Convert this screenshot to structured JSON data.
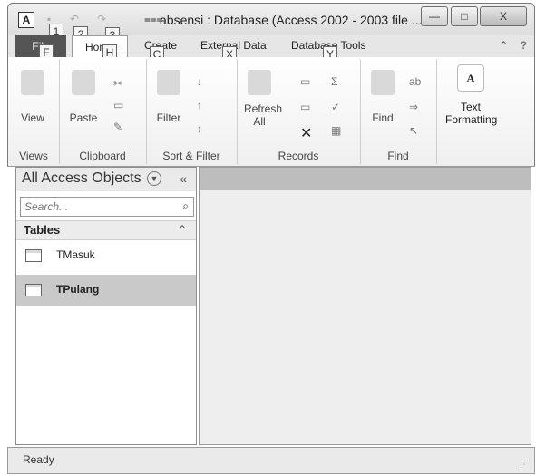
{
  "window": {
    "title": "absensi : Database (Access 2002 - 2003 file ...",
    "app_icon": "A",
    "controls": {
      "minimize": "—",
      "maximize": "□",
      "close": "X"
    }
  },
  "quick_access_keytips": [
    "1",
    "2",
    "3"
  ],
  "tabs": [
    {
      "label": "File",
      "keytip": "F"
    },
    {
      "label": "Home",
      "keytip": "H"
    },
    {
      "label": "Create",
      "keytip": "C"
    },
    {
      "label": "External Data",
      "keytip": "X"
    },
    {
      "label": "Database Tools",
      "keytip": "Y"
    }
  ],
  "ribbon": {
    "groups": {
      "views": {
        "label": "Views",
        "buttons": [
          {
            "label": "View"
          }
        ]
      },
      "clipboard": {
        "label": "Clipboard",
        "buttons": [
          {
            "label": "Paste"
          }
        ]
      },
      "sort_filter": {
        "label": "Sort & Filter",
        "buttons": [
          {
            "label": "Filter"
          }
        ]
      },
      "records": {
        "label": "Records",
        "buttons": [
          {
            "label": "Refresh"
          },
          {
            "label": "All"
          }
        ]
      },
      "find": {
        "label": "Find",
        "buttons": [
          {
            "label": "Find"
          }
        ]
      },
      "text_formatting": {
        "label": "Text Formatting",
        "glyph": "A"
      }
    }
  },
  "nav_pane": {
    "title": "All Access Objects",
    "search_placeholder": "Search...",
    "section": "Tables",
    "items": [
      {
        "name": "TMasuk",
        "selected": false
      },
      {
        "name": "TPulang",
        "selected": true
      }
    ]
  },
  "status_bar": {
    "text": "Ready"
  }
}
